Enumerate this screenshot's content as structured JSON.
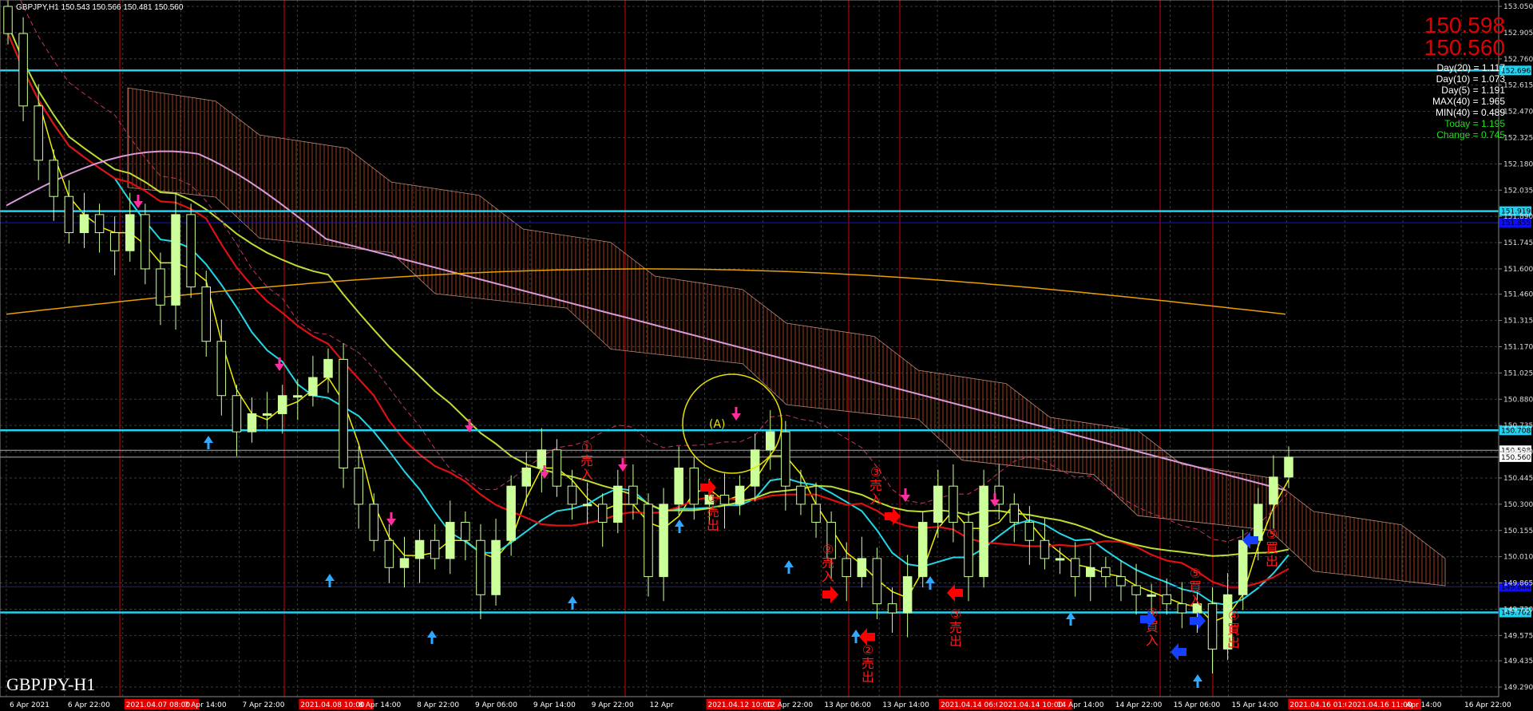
{
  "symbol_line": "GBPJPY,H1  150.543 150.566 150.481 150.560",
  "watermark": "GBPJPY-H1",
  "quote": {
    "bid1": "150.598",
    "bid2": "150.560"
  },
  "stats": {
    "day20": "Day(20) = 1.117",
    "day10": "Day(10) = 1.073",
    "day5": "Day(5) = 1.191",
    "max40": "MAX(40) = 1.965",
    "min40": "MIN(40) = 0.489",
    "today": "Today = 1.195",
    "change": "Change = 0.745"
  },
  "colors": {
    "bg": "#000000",
    "candle_up": "#ccff99",
    "grid": "#3a3a3a",
    "accent_red": "#ff0000",
    "ma_red": "#dd1111",
    "ma_yellow": "#eeee00",
    "ma_cyan": "#22d8e8",
    "ma_lime": "#bbdd33",
    "ma_pink": "#dd99dd",
    "ma_orange": "#e8a000",
    "level_cyan": "#22d0f0",
    "level_blue": "#1010ee",
    "tag_text": "#ffffff"
  },
  "chart_data": {
    "type": "candlestick",
    "symbol": "GBPJPY",
    "timeframe": "H1",
    "y_ticks": [
      "153.050",
      "152.905",
      "152.760",
      "152.615",
      "152.470",
      "152.325",
      "152.180",
      "152.035",
      "151.890",
      "151.745",
      "151.600",
      "151.460",
      "151.315",
      "151.170",
      "151.025",
      "150.880",
      "150.735",
      "150.590",
      "150.445",
      "150.300",
      "150.155",
      "150.010",
      "149.865",
      "149.720",
      "149.575",
      "149.435",
      "149.290"
    ],
    "ylim": [
      149.29,
      153.05
    ],
    "x_ticks": [
      "6 Apr 2021",
      "6 Apr 22:00",
      "2021.04.07 08:00",
      "7 Apr 14:00",
      "7 Apr 22:00",
      "2021.04.08 10:00",
      "8 Apr 14:00",
      "8 Apr 22:00",
      "9 Apr 06:00",
      "9 Apr 14:00",
      "9 Apr 22:00",
      "12 Apr",
      "2021.04.12 10:00",
      "12 Apr 22:00",
      "13 Apr 06:00",
      "13 Apr 14:00",
      "2021.04.14 06:00",
      "2021.04.14 10:00",
      "14 Apr 14:00",
      "14 Apr 22:00",
      "15 Apr 06:00",
      "15 Apr 14:00",
      "2021.04.16 01:00",
      "2021.04.16 11:00",
      "Apr 14:00",
      "16 Apr 22:00"
    ],
    "level_tags": [
      {
        "label": "152.696",
        "value": 152.696,
        "color": "#22d0f0"
      },
      {
        "label": "151.919",
        "value": 151.919,
        "color": "#22d0f0"
      },
      {
        "label": "151.855",
        "value": 151.855,
        "color": "#1010ee"
      },
      {
        "label": "150.708",
        "value": 150.708,
        "color": "#22d0f0"
      },
      {
        "label": "150.598",
        "value": 150.598,
        "color": "#ffffff"
      },
      {
        "label": "150.560",
        "value": 150.56,
        "color": "#ffffff"
      },
      {
        "label": "149.844",
        "value": 149.844,
        "color": "#1010ee"
      },
      {
        "label": "149.702",
        "value": 149.702,
        "color": "#22d0f0"
      }
    ],
    "close_series": [
      152.9,
      152.5,
      152.2,
      152.0,
      151.8,
      151.9,
      151.8,
      151.7,
      151.9,
      151.6,
      151.4,
      151.9,
      151.5,
      151.2,
      150.9,
      150.7,
      150.8,
      150.8,
      150.9,
      150.9,
      151.0,
      151.1,
      150.5,
      150.3,
      150.1,
      149.95,
      150.0,
      150.1,
      150.0,
      150.2,
      150.1,
      149.8,
      150.1,
      150.4,
      150.5,
      150.6,
      150.4,
      150.3,
      150.3,
      150.2,
      150.4,
      150.3,
      149.9,
      150.3,
      150.5,
      150.3,
      150.35,
      150.3,
      150.4,
      150.6,
      150.7,
      150.4,
      150.3,
      150.2,
      150.0,
      149.9,
      150.0,
      149.75,
      149.7,
      149.9,
      150.2,
      150.4,
      150.2,
      149.9,
      150.4,
      150.3,
      150.2,
      150.1,
      150.0,
      150.0,
      149.9,
      149.95,
      149.9,
      149.85,
      149.8,
      149.8,
      149.75,
      149.7,
      149.75,
      149.5,
      149.8,
      150.1,
      150.3,
      150.45,
      150.56
    ],
    "annotations": [
      "(A)",
      "①売入",
      "①売出",
      "②売入",
      "②売出",
      "③売入",
      "③売出",
      "④買入",
      "④買出",
      "⑤買入",
      "⑤買出"
    ]
  }
}
